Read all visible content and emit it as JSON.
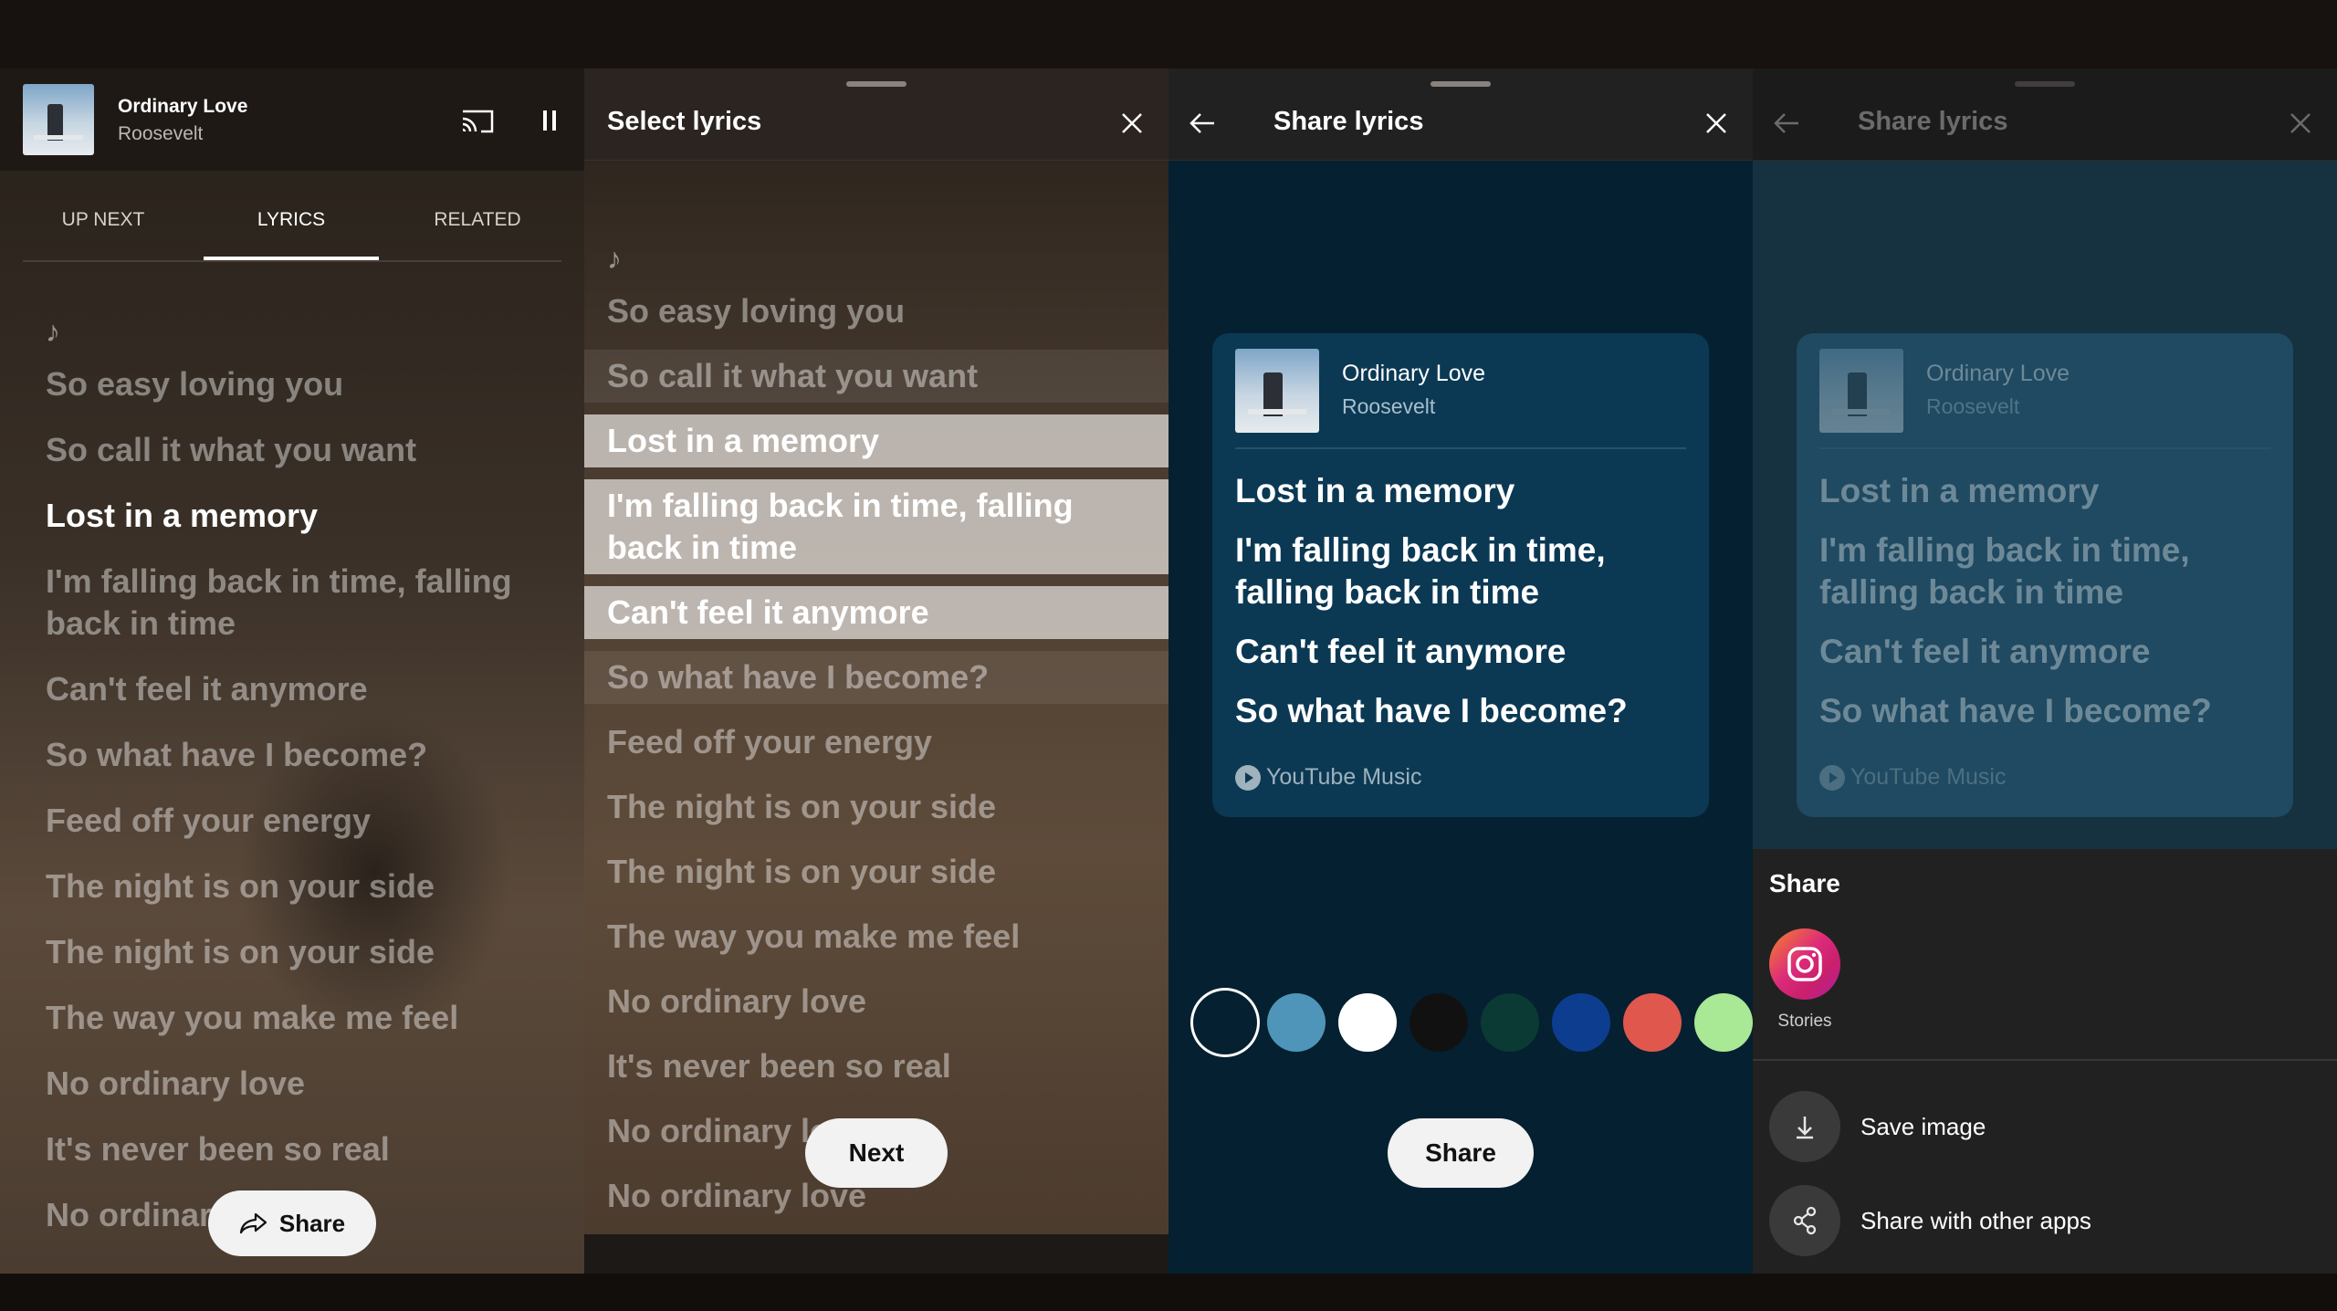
{
  "player": {
    "song_title": "Ordinary Love",
    "artist": "Roosevelt",
    "tabs": [
      "UP NEXT",
      "LYRICS",
      "RELATED"
    ],
    "note": "♪",
    "lyrics": [
      "So easy loving you",
      "So call it what you want",
      "Lost in a memory",
      "I'm falling back in time, falling back in time",
      "Can't feel it anymore",
      "So what have I become?",
      "Feed off your energy",
      "The night is on your side",
      "The night is on your side",
      "The way you make me feel",
      "No ordinary love",
      "It's never been so real",
      "No ordinary love"
    ],
    "share_label": "Share"
  },
  "select": {
    "title": "Select lyrics",
    "note": "♪",
    "lines": [
      "So easy loving you",
      "So call it what you want",
      "Lost in a memory",
      "I'm falling back in time, falling back in time",
      "Can't feel it anymore",
      "So what have I become?",
      "Feed off your energy",
      "The night is on your side",
      "The night is on your side",
      "The way you make me feel",
      "No ordinary love",
      "It's never been so real",
      "No ordinary love",
      "No ordinary love"
    ],
    "next_label": "Next"
  },
  "share": {
    "title": "Share lyrics",
    "card_title": "Ordinary Love",
    "card_artist": "Roosevelt",
    "card_lines": [
      "Lost in a memory",
      "I'm falling back in time, falling back in time",
      "Can't feel it anymore",
      "So what have I become?"
    ],
    "brand": "YouTube Music",
    "colors": [
      "#052030",
      "#4f95b9",
      "#ffffff",
      "#111111",
      "#0a3a33",
      "#0d3d8f",
      "#e0574e",
      "#a9e894"
    ],
    "share_label": "Share"
  },
  "sheet": {
    "title": "Share lyrics",
    "share_heading": "Share",
    "stories_label": "Stories",
    "save_label": "Save image",
    "other_label": "Share with other apps"
  }
}
